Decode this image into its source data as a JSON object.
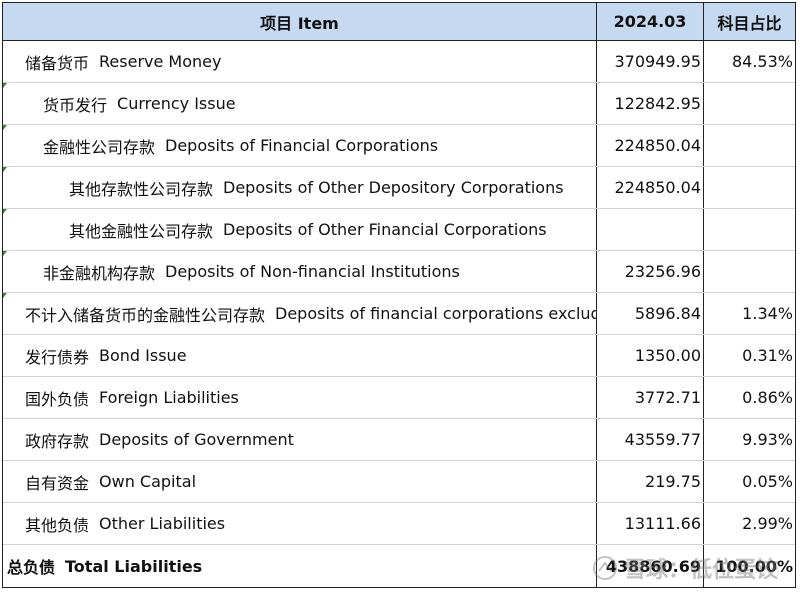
{
  "table": {
    "header": {
      "item": "项目  Item",
      "period": "2024.03",
      "share": "科目占比"
    },
    "rows": [
      {
        "cn": "储备货币",
        "en": "Reserve Money",
        "value": "370949.95",
        "share": "84.53%"
      },
      {
        "cn": "货币发行",
        "en": "Currency Issue",
        "value": "122842.95",
        "share": ""
      },
      {
        "cn": "金融性公司存款",
        "en": "Deposits of  Financial Corporations",
        "value": "224850.04",
        "share": ""
      },
      {
        "cn": "其他存款性公司存款",
        "en": "Deposits of  Other Depository Corporations",
        "value": "224850.04",
        "share": ""
      },
      {
        "cn": "其他金融性公司存款",
        "en": "Deposits of  Other Financial Corporations",
        "value": "",
        "share": ""
      },
      {
        "cn": "非金融机构存款",
        "en": "Deposits of  Non-financial Institutions",
        "value": "23256.96",
        "share": ""
      },
      {
        "cn": "不计入储备货币的金融性公司存款",
        "en": "Deposits of financial corporations excluded from reserve money",
        "value": "5896.84",
        "share": "1.34%"
      },
      {
        "cn": "发行债券",
        "en": "Bond Issue",
        "value": "1350.00",
        "share": "0.31%"
      },
      {
        "cn": "国外负债",
        "en": "Foreign Liabilities",
        "value": "3772.71",
        "share": "0.86%"
      },
      {
        "cn": "政府存款",
        "en": "Deposits of Government",
        "value": "43559.77",
        "share": "9.93%"
      },
      {
        "cn": "自有资金",
        "en": "Own Capital",
        "value": "219.75",
        "share": "0.05%"
      },
      {
        "cn": "其他负债",
        "en": "Other Liabilities",
        "value": "13111.66",
        "share": "2.99%"
      },
      {
        "cn": "总负债",
        "en": "Total  Liabilities",
        "value": "438860.69",
        "share": "100.00%"
      }
    ]
  },
  "watermark": {
    "text": "雪球：低位蛋饺",
    "icon": "snowball-logo-icon"
  }
}
